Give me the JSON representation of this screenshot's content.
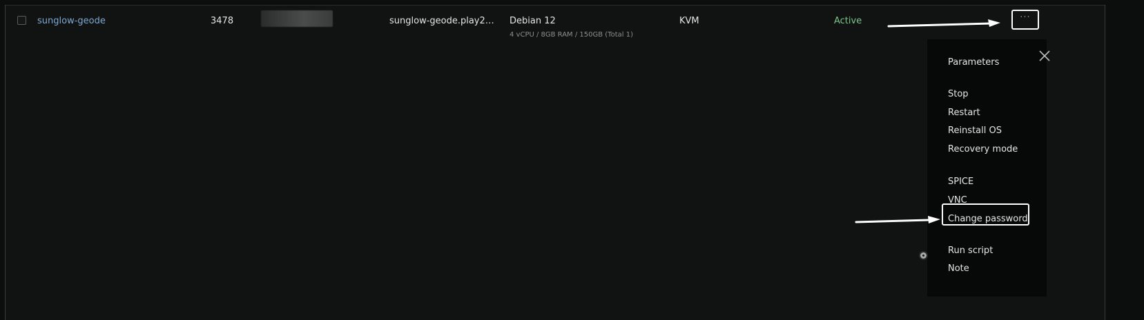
{
  "row": {
    "name": "sunglow-geode",
    "id": "3478",
    "hostname": "sunglow-geode.play2go...",
    "os": "Debian 12",
    "specs": "4 vCPU / 8GB RAM / 150GB (Total 1)",
    "virtualization": "KVM",
    "status": "Active",
    "actions_label": "···"
  },
  "menu": {
    "items": [
      {
        "label": "Parameters"
      },
      {
        "label": "Stop"
      },
      {
        "label": "Restart"
      },
      {
        "label": "Reinstall OS"
      },
      {
        "label": "Recovery mode"
      },
      {
        "label": "SPICE"
      },
      {
        "label": "VNC"
      },
      {
        "label": "Change password"
      },
      {
        "label": "Run script"
      },
      {
        "label": "Note"
      }
    ]
  },
  "colors": {
    "link": "#7fa9d2",
    "status_active": "#7ec68a",
    "background": "#111313",
    "menu_background": "#070808"
  }
}
